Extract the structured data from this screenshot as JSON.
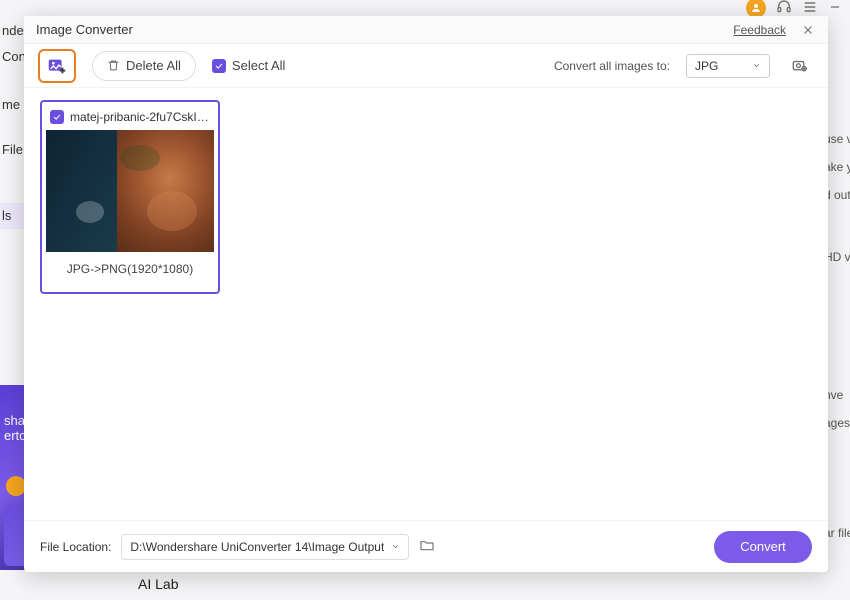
{
  "background": {
    "sidebar_frags": [
      "nde",
      "Con",
      "me",
      "File",
      "ls"
    ],
    "right_snippets": [
      "use v",
      "ake y",
      "d out",
      "HD v",
      "nve",
      "ages",
      "ar file"
    ],
    "bottom_label": "AI Lab",
    "promo_lines": [
      "sha",
      "erto"
    ]
  },
  "modal": {
    "title": "Image Converter",
    "feedback": "Feedback"
  },
  "toolbar": {
    "delete_all": "Delete All",
    "select_all": "Select All",
    "convert_to_label": "Convert all images to:",
    "format_selected": "JPG"
  },
  "items": [
    {
      "filename": "matej-pribanic-2fu7CskIT...",
      "conversion": "JPG->PNG(1920*1080)"
    }
  ],
  "footer": {
    "label": "File Location:",
    "path": "D:\\Wondershare UniConverter 14\\Image Output",
    "convert": "Convert"
  }
}
